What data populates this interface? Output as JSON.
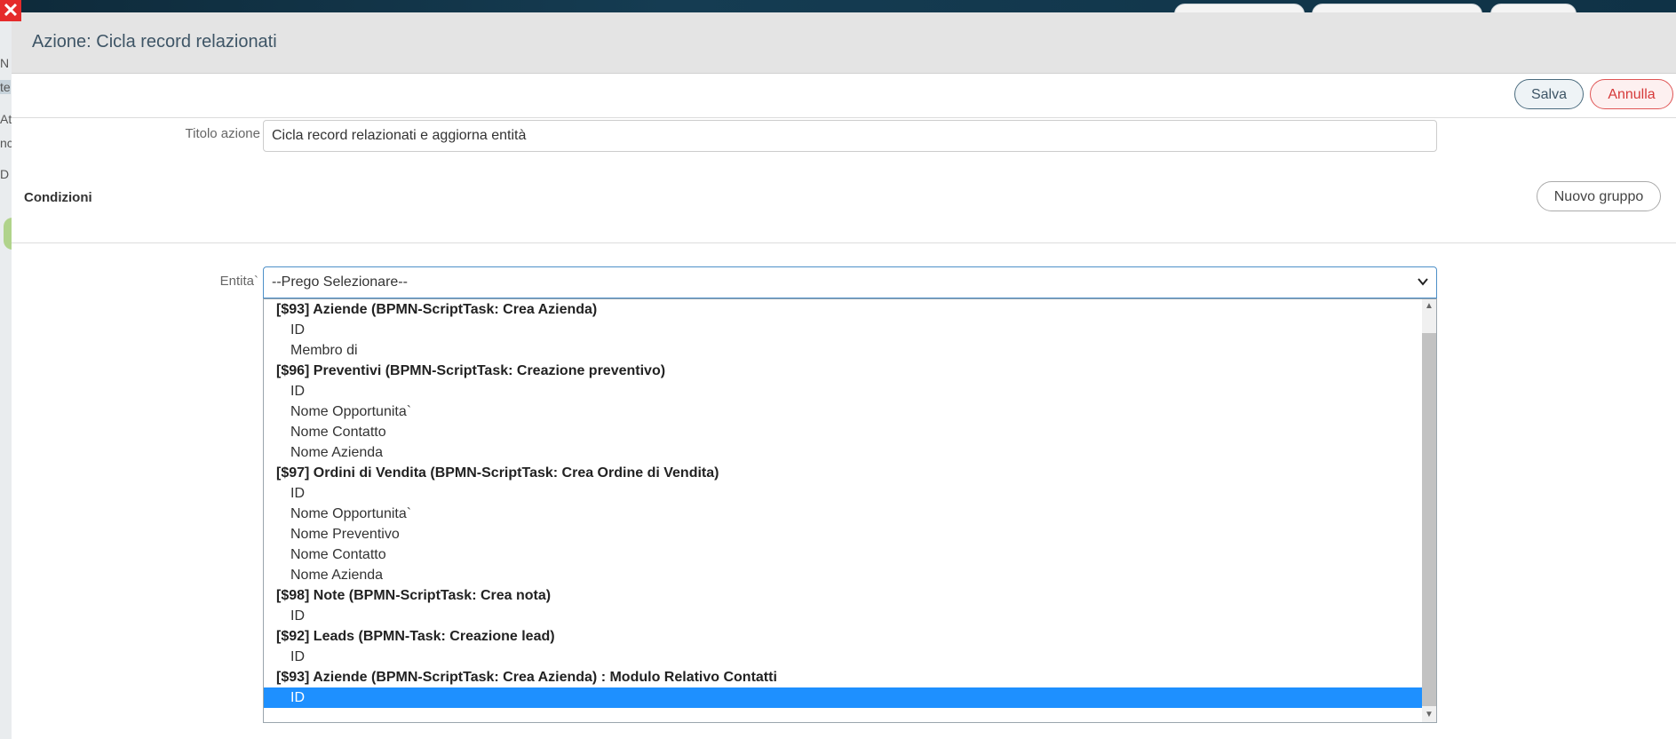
{
  "background": {
    "left_fragments": [
      "N",
      "te",
      "At",
      "nc",
      "D"
    ]
  },
  "close_icon": "✕",
  "modal": {
    "title": "Azione: Cicla record relazionati"
  },
  "toolbar": {
    "save_label": "Salva",
    "cancel_label": "Annulla"
  },
  "form": {
    "title_label": "Titolo azione",
    "title_value": "Cicla record relazionati e aggiorna entità",
    "conditions_title": "Condizioni",
    "new_group_label": "Nuovo gruppo",
    "entity_label": "Entita`",
    "entity_selected": "--Prego Selezionare--"
  },
  "dropdown": {
    "options": [
      {
        "text": "[$93] Aziende (BPMN-ScriptTask: Crea Azienda)",
        "group": true
      },
      {
        "text": "ID",
        "group": false
      },
      {
        "text": "Membro di",
        "group": false
      },
      {
        "text": "[$96] Preventivi (BPMN-ScriptTask: Creazione preventivo)",
        "group": true
      },
      {
        "text": "ID",
        "group": false
      },
      {
        "text": "Nome Opportunita`",
        "group": false
      },
      {
        "text": "Nome Contatto",
        "group": false
      },
      {
        "text": "Nome Azienda",
        "group": false
      },
      {
        "text": "[$97] Ordini di Vendita (BPMN-ScriptTask: Crea Ordine di Vendita)",
        "group": true
      },
      {
        "text": "ID",
        "group": false
      },
      {
        "text": "Nome Opportunita`",
        "group": false
      },
      {
        "text": "Nome Preventivo",
        "group": false
      },
      {
        "text": "Nome Contatto",
        "group": false
      },
      {
        "text": "Nome Azienda",
        "group": false
      },
      {
        "text": "[$98] Note (BPMN-ScriptTask: Crea nota)",
        "group": true
      },
      {
        "text": "ID",
        "group": false
      },
      {
        "text": "[$92] Leads (BPMN-Task: Creazione lead)",
        "group": true
      },
      {
        "text": "ID",
        "group": false
      },
      {
        "text": "[$93] Aziende (BPMN-ScriptTask: Crea Azienda) : Modulo Relativo Contatti",
        "group": true
      },
      {
        "text": "ID",
        "group": false,
        "selected": true
      }
    ]
  },
  "colors": {
    "accent": "#1e90ff",
    "cancel": "#d63a3a",
    "header_bg": "#e4e4e4"
  }
}
